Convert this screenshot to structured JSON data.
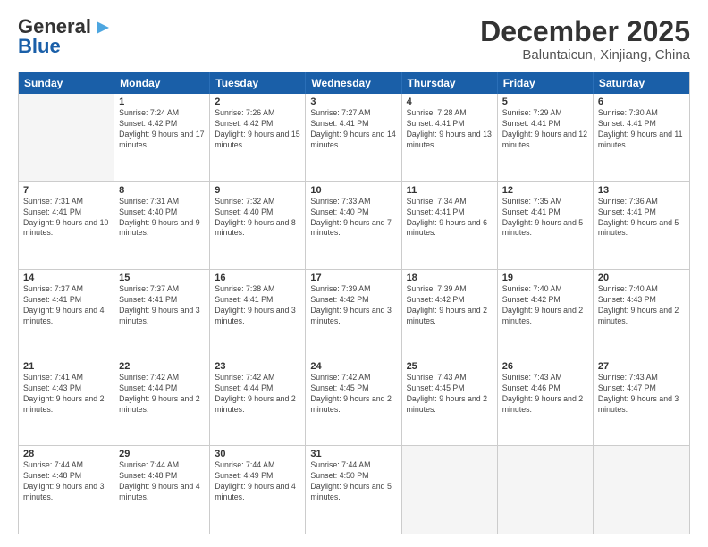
{
  "logo": {
    "line1": "General",
    "line2": "Blue"
  },
  "title": "December 2025",
  "subtitle": "Baluntaicun, Xinjiang, China",
  "header_days": [
    "Sunday",
    "Monday",
    "Tuesday",
    "Wednesday",
    "Thursday",
    "Friday",
    "Saturday"
  ],
  "rows": [
    [
      {
        "num": "",
        "info": ""
      },
      {
        "num": "1",
        "info": "Sunrise: 7:24 AM\nSunset: 4:42 PM\nDaylight: 9 hours\nand 17 minutes."
      },
      {
        "num": "2",
        "info": "Sunrise: 7:26 AM\nSunset: 4:42 PM\nDaylight: 9 hours\nand 15 minutes."
      },
      {
        "num": "3",
        "info": "Sunrise: 7:27 AM\nSunset: 4:41 PM\nDaylight: 9 hours\nand 14 minutes."
      },
      {
        "num": "4",
        "info": "Sunrise: 7:28 AM\nSunset: 4:41 PM\nDaylight: 9 hours\nand 13 minutes."
      },
      {
        "num": "5",
        "info": "Sunrise: 7:29 AM\nSunset: 4:41 PM\nDaylight: 9 hours\nand 12 minutes."
      },
      {
        "num": "6",
        "info": "Sunrise: 7:30 AM\nSunset: 4:41 PM\nDaylight: 9 hours\nand 11 minutes."
      }
    ],
    [
      {
        "num": "7",
        "info": "Sunrise: 7:31 AM\nSunset: 4:41 PM\nDaylight: 9 hours\nand 10 minutes."
      },
      {
        "num": "8",
        "info": "Sunrise: 7:31 AM\nSunset: 4:40 PM\nDaylight: 9 hours\nand 9 minutes."
      },
      {
        "num": "9",
        "info": "Sunrise: 7:32 AM\nSunset: 4:40 PM\nDaylight: 9 hours\nand 8 minutes."
      },
      {
        "num": "10",
        "info": "Sunrise: 7:33 AM\nSunset: 4:40 PM\nDaylight: 9 hours\nand 7 minutes."
      },
      {
        "num": "11",
        "info": "Sunrise: 7:34 AM\nSunset: 4:41 PM\nDaylight: 9 hours\nand 6 minutes."
      },
      {
        "num": "12",
        "info": "Sunrise: 7:35 AM\nSunset: 4:41 PM\nDaylight: 9 hours\nand 5 minutes."
      },
      {
        "num": "13",
        "info": "Sunrise: 7:36 AM\nSunset: 4:41 PM\nDaylight: 9 hours\nand 5 minutes."
      }
    ],
    [
      {
        "num": "14",
        "info": "Sunrise: 7:37 AM\nSunset: 4:41 PM\nDaylight: 9 hours\nand 4 minutes."
      },
      {
        "num": "15",
        "info": "Sunrise: 7:37 AM\nSunset: 4:41 PM\nDaylight: 9 hours\nand 3 minutes."
      },
      {
        "num": "16",
        "info": "Sunrise: 7:38 AM\nSunset: 4:41 PM\nDaylight: 9 hours\nand 3 minutes."
      },
      {
        "num": "17",
        "info": "Sunrise: 7:39 AM\nSunset: 4:42 PM\nDaylight: 9 hours\nand 3 minutes."
      },
      {
        "num": "18",
        "info": "Sunrise: 7:39 AM\nSunset: 4:42 PM\nDaylight: 9 hours\nand 2 minutes."
      },
      {
        "num": "19",
        "info": "Sunrise: 7:40 AM\nSunset: 4:42 PM\nDaylight: 9 hours\nand 2 minutes."
      },
      {
        "num": "20",
        "info": "Sunrise: 7:40 AM\nSunset: 4:43 PM\nDaylight: 9 hours\nand 2 minutes."
      }
    ],
    [
      {
        "num": "21",
        "info": "Sunrise: 7:41 AM\nSunset: 4:43 PM\nDaylight: 9 hours\nand 2 minutes."
      },
      {
        "num": "22",
        "info": "Sunrise: 7:42 AM\nSunset: 4:44 PM\nDaylight: 9 hours\nand 2 minutes."
      },
      {
        "num": "23",
        "info": "Sunrise: 7:42 AM\nSunset: 4:44 PM\nDaylight: 9 hours\nand 2 minutes."
      },
      {
        "num": "24",
        "info": "Sunrise: 7:42 AM\nSunset: 4:45 PM\nDaylight: 9 hours\nand 2 minutes."
      },
      {
        "num": "25",
        "info": "Sunrise: 7:43 AM\nSunset: 4:45 PM\nDaylight: 9 hours\nand 2 minutes."
      },
      {
        "num": "26",
        "info": "Sunrise: 7:43 AM\nSunset: 4:46 PM\nDaylight: 9 hours\nand 2 minutes."
      },
      {
        "num": "27",
        "info": "Sunrise: 7:43 AM\nSunset: 4:47 PM\nDaylight: 9 hours\nand 3 minutes."
      }
    ],
    [
      {
        "num": "28",
        "info": "Sunrise: 7:44 AM\nSunset: 4:48 PM\nDaylight: 9 hours\nand 3 minutes."
      },
      {
        "num": "29",
        "info": "Sunrise: 7:44 AM\nSunset: 4:48 PM\nDaylight: 9 hours\nand 4 minutes."
      },
      {
        "num": "30",
        "info": "Sunrise: 7:44 AM\nSunset: 4:49 PM\nDaylight: 9 hours\nand 4 minutes."
      },
      {
        "num": "31",
        "info": "Sunrise: 7:44 AM\nSunset: 4:50 PM\nDaylight: 9 hours\nand 5 minutes."
      },
      {
        "num": "",
        "info": ""
      },
      {
        "num": "",
        "info": ""
      },
      {
        "num": "",
        "info": ""
      }
    ]
  ]
}
